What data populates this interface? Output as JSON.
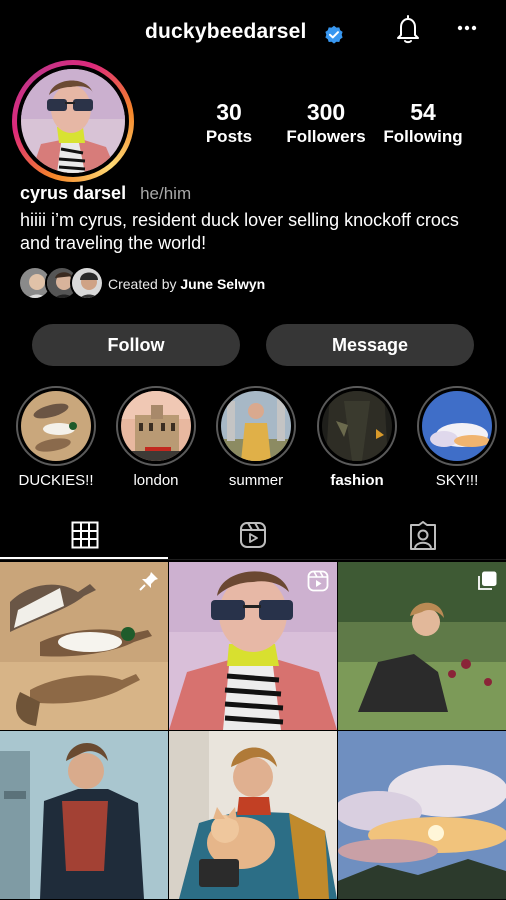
{
  "header": {
    "username": "duckybeedarsel",
    "verified_color": "#3897f0",
    "icons": [
      "verified-badge-icon",
      "bell-icon",
      "more-icon"
    ]
  },
  "profile": {
    "stats": [
      {
        "num": "30",
        "label": "Posts"
      },
      {
        "num": "300",
        "label": "Followers"
      },
      {
        "num": "54",
        "label": "Following"
      }
    ],
    "name": "cyrus darsel",
    "pronouns": "he/him",
    "bio": "hiiii i’m cyrus, resident duck lover selling knockoff crocs and traveling the world!",
    "created_by_prefix": "Created by",
    "created_by_name": "June Selwyn"
  },
  "actions": {
    "follow": "Follow",
    "message": "Message"
  },
  "highlights": [
    {
      "label": "DUCKIES!!",
      "bold": false
    },
    {
      "label": "london",
      "bold": false
    },
    {
      "label": "summer",
      "bold": false
    },
    {
      "label": "fashion",
      "bold": true
    },
    {
      "label": "SKY!!!",
      "bold": false
    }
  ],
  "tabs": [
    {
      "name": "grid-icon",
      "active": true
    },
    {
      "name": "reels-icon",
      "active": false
    },
    {
      "name": "tagged-icon",
      "active": false
    }
  ],
  "grid_badges": [
    "pin-icon",
    "reel-icon",
    "carousel-icon"
  ]
}
